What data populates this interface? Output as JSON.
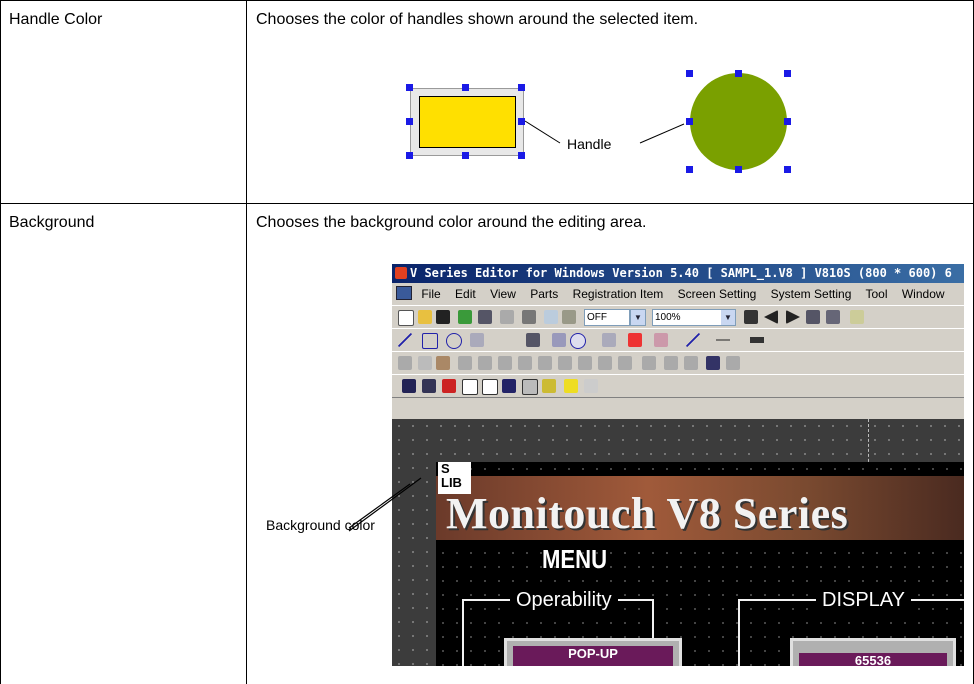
{
  "rows": [
    {
      "name": "Handle Color",
      "description": "Chooses the color of handles shown around the selected item.",
      "illustration": {
        "label": "Handle",
        "rect_fill": "#ffe000",
        "circle_fill": "#7aa000",
        "handle_color": "#1a1ae6"
      }
    },
    {
      "name": "Background",
      "description": "Chooses the background color around the editing area.",
      "illustration": {
        "label": "Background color"
      }
    }
  ],
  "editor": {
    "title": "V Series Editor for Windows Version 5.40 [ SAMPL_1.V8 ] V810S (800 * 600) 6",
    "menus": [
      "File",
      "Edit",
      "View",
      "Parts",
      "Registration Item",
      "Screen Setting",
      "System Setting",
      "Tool",
      "Window"
    ],
    "toolbar": {
      "off_combo": "OFF",
      "zoom_combo": "100%"
    },
    "screen": {
      "logo": "S LIB",
      "banner": "Monitouch V8 Series",
      "menu_title": "MENU",
      "groups": [
        "Operability",
        "DISPLAY"
      ],
      "buttons": [
        "POP-UP",
        "65536"
      ]
    }
  }
}
